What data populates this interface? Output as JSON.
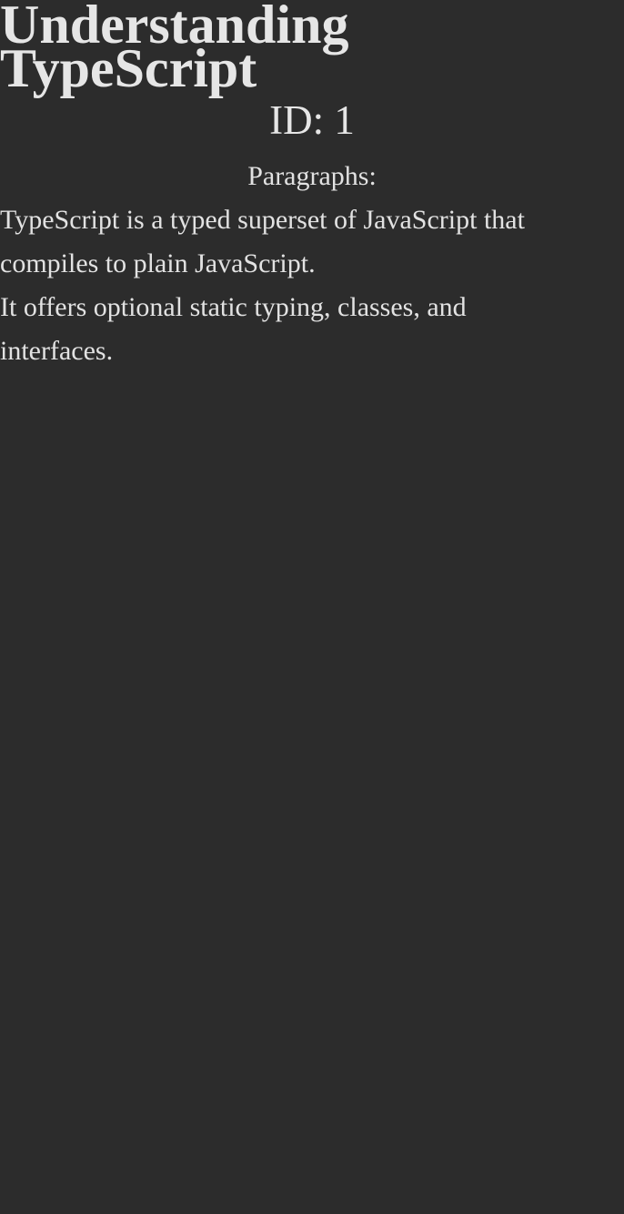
{
  "article": {
    "title": "Understanding TypeScript",
    "id_label": "ID:",
    "id_value": "1",
    "paragraphs_heading": "Paragraphs:",
    "paragraphs": [
      "TypeScript is a typed superset of JavaScript that compiles to plain JavaScript.",
      "It offers optional static typing, classes, and interfaces."
    ]
  },
  "colors": {
    "background": "#2c2c2c",
    "text": "#e2e2e2"
  }
}
